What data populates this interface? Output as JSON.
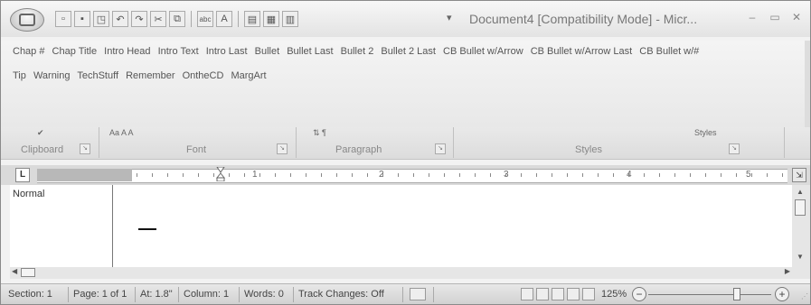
{
  "window": {
    "title": "Document4 [Compatibility Mode] - Micr...",
    "minimize_glyph": "–",
    "maximize_glyph": "▭",
    "close_glyph": "✕"
  },
  "qat": {
    "dropdown_glyph": "▾",
    "icons": [
      "new-document-icon",
      "save-icon",
      "open-icon",
      "undo-icon",
      "redo-icon",
      "spelling-icon",
      "cut-icon",
      "copy-icon",
      "text-highlight-icon",
      "font-color-icon",
      "document-view-icon",
      "print-layout-icon",
      "draft-view-icon"
    ]
  },
  "gallery": {
    "row1": [
      "Chap #",
      "Chap Title",
      "Intro Head",
      "Intro Text",
      "Intro Last",
      "Bullet",
      "Bullet Last",
      "Bullet 2",
      "Bullet 2 Last",
      "CB Bullet w/Arrow",
      "CB Bullet w/Arrow Last",
      "CB Bullet w/#"
    ],
    "row2": [
      "Tip",
      "Warning",
      "TechStuff",
      "Remember",
      "OntheCD",
      "MargArt"
    ]
  },
  "ribbon": {
    "groups": [
      {
        "label": "Clipboard",
        "launcher": "↘"
      },
      {
        "label": "Font",
        "launcher": "↘"
      },
      {
        "label": "Paragraph",
        "launcher": "↘"
      },
      {
        "label": "Styles",
        "launcher": "↘"
      }
    ],
    "styles_top_label": "Styles",
    "font_top_icons": "Aa  A  A"
  },
  "ruler": {
    "tab_selector": "L",
    "numbers": [
      "1",
      "2",
      "3",
      "4",
      "5"
    ]
  },
  "document": {
    "style_area_label": "Normal"
  },
  "statusbar": {
    "section": "Section: 1",
    "page": "Page: 1 of 1",
    "at": "At: 1.8\"",
    "column": "Column: 1",
    "words": "Words: 0",
    "track_changes": "Track Changes: Off",
    "zoom_level": "125%",
    "zoom_out": "−",
    "zoom_in": "+",
    "zoom_slider_position": 0.72
  }
}
